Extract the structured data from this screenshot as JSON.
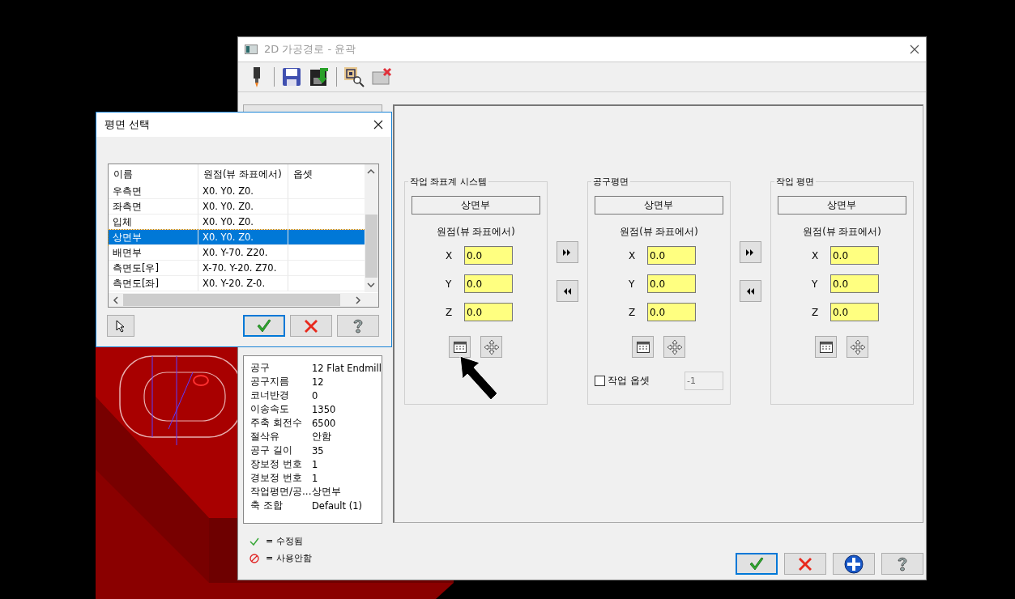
{
  "window": {
    "title": "2D 가공경로 - 윤곽"
  },
  "plane_dialog": {
    "title": "평면 선택",
    "columns": [
      "이름",
      "원점(뷰 좌표에서)",
      "옵셋"
    ],
    "rows": [
      {
        "name": "우측면",
        "origin": "X0. Y0. Z0.",
        "selected": false
      },
      {
        "name": "좌측면",
        "origin": "X0. Y0. Z0.",
        "selected": false
      },
      {
        "name": "입체",
        "origin": "X0. Y0. Z0.",
        "selected": false
      },
      {
        "name": "상면부",
        "origin": "X0. Y0. Z0.",
        "selected": true
      },
      {
        "name": "배면부",
        "origin": "X0. Y-70. Z20.",
        "selected": false
      },
      {
        "name": "측면도[우]",
        "origin": "X-70. Y-20. Z70.",
        "selected": false
      },
      {
        "name": "측면도[좌]",
        "origin": "X0. Y-20. Z-0.",
        "selected": false
      }
    ]
  },
  "tool_info": [
    {
      "label": "공구",
      "value": "12 Flat Endmill"
    },
    {
      "label": "공구지름",
      "value": "12"
    },
    {
      "label": "코너반경",
      "value": "0"
    },
    {
      "label": "이송속도",
      "value": "1350"
    },
    {
      "label": "주축 회전수",
      "value": "6500"
    },
    {
      "label": "절삭유",
      "value": "안함"
    },
    {
      "label": "공구 길이",
      "value": "35"
    },
    {
      "label": "장보정 번호",
      "value": "1"
    },
    {
      "label": "경보정 번호",
      "value": "1"
    },
    {
      "label": "작업평면/공...",
      "value": "상면부"
    },
    {
      "label": "축 조합",
      "value": "Default (1)"
    }
  ],
  "legend": [
    {
      "kind": "edited",
      "label": "= 수정됨"
    },
    {
      "kind": "disabled",
      "label": "= 사용안함"
    }
  ],
  "planes": [
    {
      "title": "작업 좌표계 시스템",
      "plane": "상면부",
      "origin_label": "원점(뷰 좌표에서)",
      "coords": [
        {
          "axis": "X",
          "value": "0.0"
        },
        {
          "axis": "Y",
          "value": "0.0"
        },
        {
          "axis": "Z",
          "value": "0.0"
        }
      ]
    },
    {
      "title": "공구평면",
      "plane": "상면부",
      "origin_label": "원점(뷰 좌표에서)",
      "coords": [
        {
          "axis": "X",
          "value": "0.0"
        },
        {
          "axis": "Y",
          "value": "0.0"
        },
        {
          "axis": "Z",
          "value": "0.0"
        }
      ],
      "work_offset": {
        "label": "작업 옵셋",
        "checked": false,
        "value": "-1",
        "disabled": true
      }
    },
    {
      "title": "작업 평면",
      "plane": "상면부",
      "origin_label": "원점(뷰 좌표에서)",
      "coords": [
        {
          "axis": "X",
          "value": "0.0"
        },
        {
          "axis": "Y",
          "value": "0.0"
        },
        {
          "axis": "Z",
          "value": "0.0"
        }
      ]
    }
  ]
}
